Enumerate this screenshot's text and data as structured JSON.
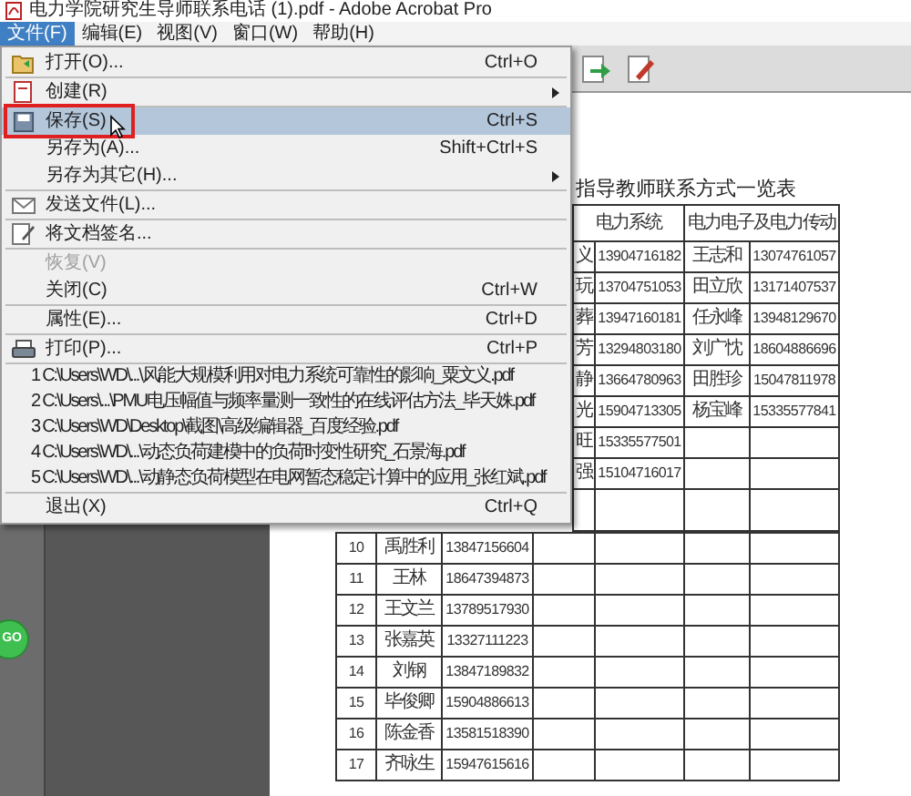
{
  "title_bar": {
    "title": "电力学院研究生导师联系电话 (1).pdf - Adobe Acrobat Pro"
  },
  "menu_bar": [
    {
      "label": "文件(F)",
      "selected": true
    },
    {
      "label": "编辑(E)",
      "selected": false
    },
    {
      "label": "视图(V)",
      "selected": false
    },
    {
      "label": "窗口(W)",
      "selected": false
    },
    {
      "label": "帮助(H)",
      "selected": false
    }
  ],
  "file_menu": [
    {
      "kind": "item",
      "label": "打开(O)...",
      "shortcut": "Ctrl+O",
      "submenu": false,
      "disabled": false,
      "highlighted": false
    },
    {
      "kind": "separator"
    },
    {
      "kind": "item",
      "label": "创建(R)",
      "submenu": true,
      "disabled": false,
      "highlighted": false
    },
    {
      "kind": "separator"
    },
    {
      "kind": "item",
      "label": "保存(S)",
      "shortcut": "Ctrl+S",
      "submenu": false,
      "disabled": false,
      "highlighted": true
    },
    {
      "kind": "item",
      "label": "另存为(A)...",
      "shortcut": "Shift+Ctrl+S",
      "submenu": false,
      "disabled": false,
      "highlighted": false
    },
    {
      "kind": "item",
      "label": "另存为其它(H)...",
      "submenu": true,
      "disabled": false,
      "highlighted": false
    },
    {
      "kind": "separator"
    },
    {
      "kind": "item",
      "label": "发送文件(L)...",
      "submenu": false,
      "disabled": false,
      "highlighted": false
    },
    {
      "kind": "separator"
    },
    {
      "kind": "item",
      "label": "将文档签名...",
      "submenu": false,
      "disabled": false,
      "highlighted": false
    },
    {
      "kind": "separator"
    },
    {
      "kind": "item",
      "label": "恢复(V)",
      "submenu": false,
      "disabled": true,
      "highlighted": false
    },
    {
      "kind": "item",
      "label": "关闭(C)",
      "shortcut": "Ctrl+W",
      "submenu": false,
      "disabled": false,
      "highlighted": false
    },
    {
      "kind": "separator"
    },
    {
      "kind": "item",
      "label": "属性(E)...",
      "shortcut": "Ctrl+D",
      "submenu": false,
      "disabled": false,
      "highlighted": false
    },
    {
      "kind": "separator"
    },
    {
      "kind": "item",
      "label": "打印(P)...",
      "shortcut": "Ctrl+P",
      "submenu": false,
      "disabled": false,
      "highlighted": false
    },
    {
      "kind": "separator"
    },
    {
      "kind": "recent",
      "label": "1 C:\\Users\\WD\\...\\风能大规模利用对电力系统可靠性的影响_粟文义.pdf"
    },
    {
      "kind": "recent",
      "label": "2 C:\\Users\\...\\PMU电压幅值与频率量测一致性的在线评估方法_毕天姝.pdf"
    },
    {
      "kind": "recent",
      "label": "3 C:\\Users\\WD\\Desktop\\截图\\高级编辑器_百度经验.pdf"
    },
    {
      "kind": "recent",
      "label": "4 C:\\Users\\WD\\...\\动态负荷建模中的负荷时变性研究_石景海.pdf"
    },
    {
      "kind": "recent",
      "label": "5 C:\\Users\\WD\\...\\动静态负荷模型在电网暂态稳定计算中的应用_张红斌.pdf"
    },
    {
      "kind": "separator"
    },
    {
      "kind": "item",
      "label": "退出(X)",
      "shortcut": "Ctrl+Q",
      "submenu": false,
      "disabled": false,
      "highlighted": false
    }
  ],
  "side_button": {
    "label": "GO"
  },
  "document": {
    "heading": "指导教师联系方式一览表",
    "upper_table": {
      "headers": [
        "电力系统",
        "电力电子及电力传动"
      ],
      "rows": [
        [
          "义",
          "13904716182",
          "王志和",
          "13074761057"
        ],
        [
          "玩",
          "13704751053",
          "田立欣",
          "13171407537"
        ],
        [
          "葬",
          "13947160181",
          "任永峰",
          "13948129670"
        ],
        [
          "芳",
          "13294803180",
          "刘广忱",
          "18604886696"
        ],
        [
          "静",
          "13664780963",
          "田胜珍",
          "15047811978"
        ],
        [
          "光",
          "15904713305",
          "杨宝峰",
          "15335577841"
        ],
        [
          "旺",
          "15335577501"
        ],
        [
          "强",
          "15104716017"
        ]
      ]
    },
    "lower_table": {
      "rows": [
        [
          "10",
          "禹胜利",
          "13847156604"
        ],
        [
          "11",
          "王林",
          "18647394873"
        ],
        [
          "12",
          "王文兰",
          "13789517930"
        ],
        [
          "13",
          "张嘉英",
          "13327111223"
        ],
        [
          "14",
          "刘钢",
          "13847189832"
        ],
        [
          "15",
          "毕俊卿",
          "15904886613"
        ],
        [
          "16",
          "陈金香",
          "13581518390"
        ],
        [
          "17",
          "齐咏生",
          "15947615616"
        ]
      ]
    }
  }
}
